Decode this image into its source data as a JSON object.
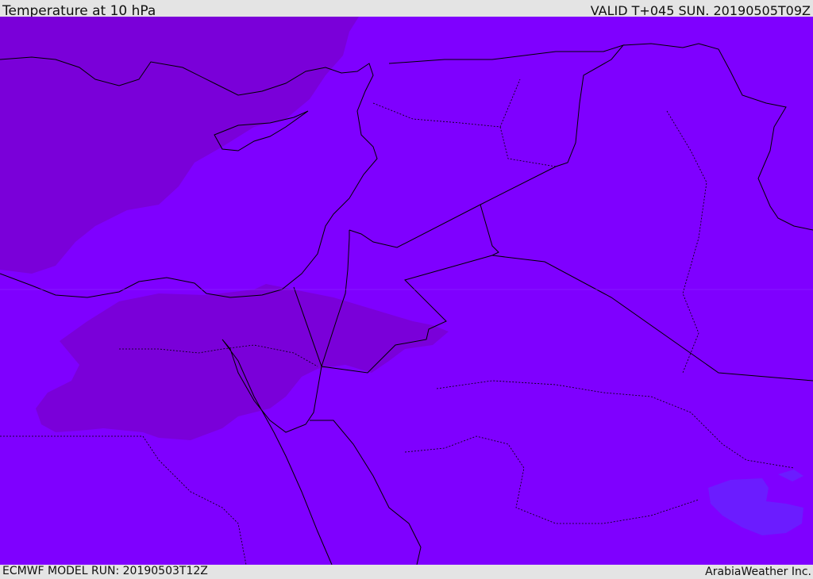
{
  "header": {
    "title": "Temperature at 10 hPa",
    "valid": "VALID T+045 SUN. 20190505T09Z"
  },
  "footer": {
    "model_run": "ECMWF MODEL RUN: 20190503T12Z",
    "brand": "ArabiaWeather Inc."
  },
  "colors": {
    "field_main": "#7f00ff",
    "field_dark": "#7a00d9",
    "field_light": "#6b1cff",
    "coastline": "#000000"
  }
}
